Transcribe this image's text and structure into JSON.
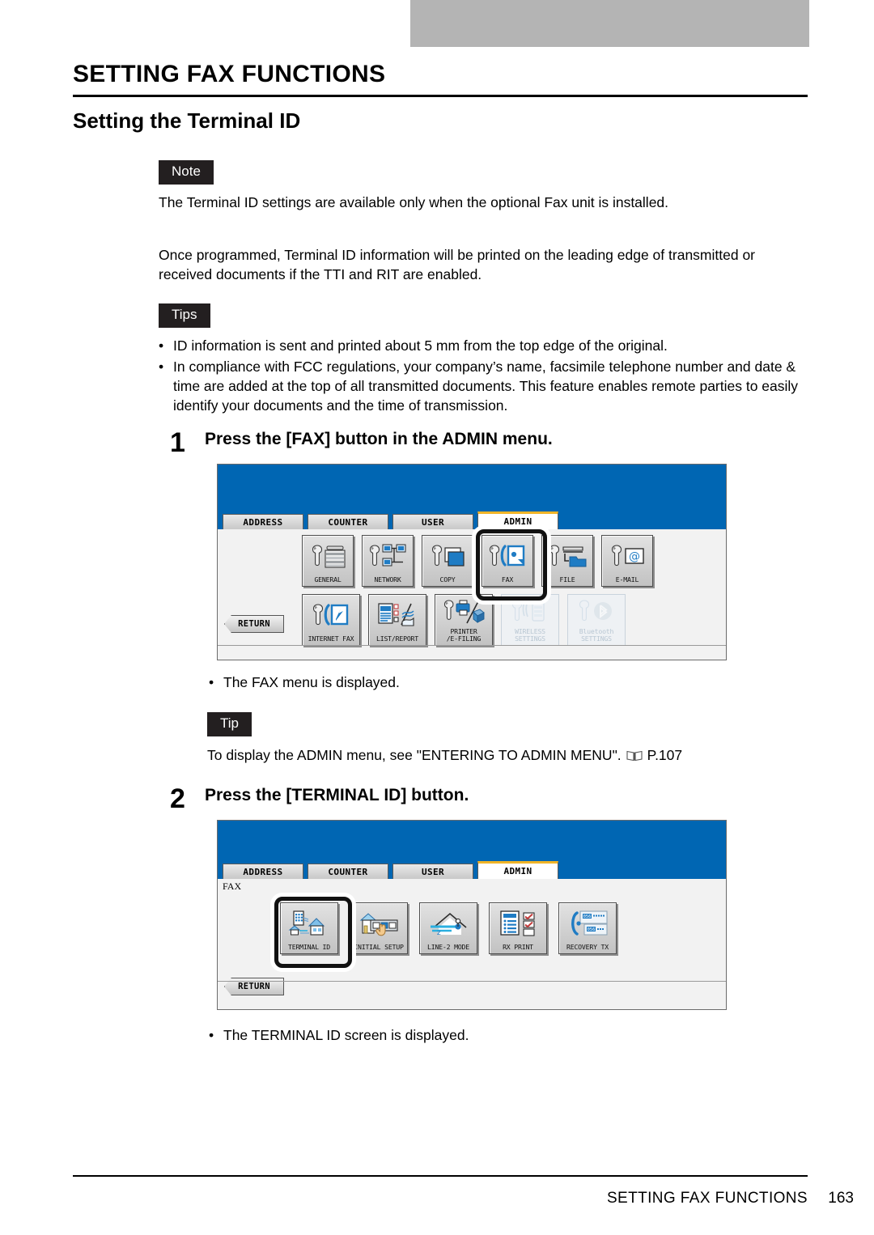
{
  "page": {
    "chapter_title": "SETTING FAX FUNCTIONS",
    "section_title": "Setting the Terminal ID",
    "footer_title": "SETTING FAX FUNCTIONS",
    "footer_page": "163"
  },
  "note": {
    "label": "Note",
    "text": "The Terminal ID settings are available only when the optional Fax unit is installed."
  },
  "intro": {
    "line1": "Once programmed, Terminal ID information will be printed on the leading edge of transmitted or",
    "line2": "received documents if the TTI and RIT are enabled."
  },
  "tips": {
    "label": "Tips",
    "items": [
      "ID information is sent and printed about 5 mm from the top edge of the original.",
      "In compliance with FCC regulations, your company’s name, facsimile telephone number and date & time are added at the top of all transmitted documents.  This feature enables remote parties to easily identify your documents and the time of transmission."
    ]
  },
  "steps": [
    {
      "number": "1",
      "heading": "Press the [FAX] button in the ADMIN menu.",
      "result_bullet": "The FAX menu is displayed."
    },
    {
      "number": "2",
      "heading": "Press the [TERMINAL ID] button.",
      "result_bullet": "The TERMINAL ID screen is displayed."
    }
  ],
  "tip": {
    "label": "Tip",
    "text": "To display the ADMIN menu, see \"ENTERING TO ADMIN MENU\".",
    "ref_page": "P.107"
  },
  "screen1": {
    "tabs": [
      {
        "label": "ADDRESS",
        "active": false
      },
      {
        "label": "COUNTER",
        "active": false
      },
      {
        "label": "USER",
        "active": false
      },
      {
        "label": "ADMIN",
        "active": true
      }
    ],
    "row1": [
      {
        "caption": "GENERAL",
        "icon": "wrench-copier-icon",
        "disabled": false,
        "selected": false
      },
      {
        "caption": "NETWORK",
        "icon": "wrench-network-icon",
        "disabled": false,
        "selected": false
      },
      {
        "caption": "COPY",
        "icon": "wrench-copy-icon",
        "disabled": false,
        "selected": false
      },
      {
        "caption": "FAX",
        "icon": "wrench-fax-icon",
        "disabled": false,
        "selected": true
      },
      {
        "caption": "FILE",
        "icon": "wrench-file-icon",
        "disabled": false,
        "selected": false
      },
      {
        "caption": "E-MAIL",
        "icon": "wrench-email-icon",
        "disabled": false,
        "selected": false
      }
    ],
    "row2": [
      {
        "caption": "INTERNET FAX",
        "icon": "wrench-internet-fax-icon",
        "disabled": false,
        "selected": false
      },
      {
        "caption": "LIST/REPORT",
        "icon": "list-report-icon",
        "disabled": false,
        "selected": false
      },
      {
        "caption": "PRINTER\n/E-FILING",
        "icon": "wrench-printer-efiling-icon",
        "disabled": false,
        "selected": false
      },
      {
        "caption": "WIRELESS\nSETTINGS",
        "icon": "wrench-wireless-icon",
        "disabled": true,
        "selected": false
      },
      {
        "caption": "Bluetooth\nSETTINGS",
        "icon": "wrench-bluetooth-icon",
        "disabled": true,
        "selected": false
      }
    ],
    "return_label": "RETURN"
  },
  "screen2": {
    "tabs": [
      {
        "label": "ADDRESS",
        "active": false
      },
      {
        "label": "COUNTER",
        "active": false
      },
      {
        "label": "USER",
        "active": false
      },
      {
        "label": "ADMIN",
        "active": true
      }
    ],
    "breadcrumb": "FAX",
    "buttons": [
      {
        "caption": "TERMINAL  ID",
        "icon": "buildings-house-icon",
        "selected": true
      },
      {
        "caption": "INITIAL SETUP",
        "icon": "hand-setup-icon",
        "selected": false
      },
      {
        "caption": "LINE-2 MODE",
        "icon": "line2-house-icon",
        "selected": false
      },
      {
        "caption": "RX PRINT",
        "icon": "rx-print-icon",
        "selected": false
      },
      {
        "caption": "RECOVERY TX",
        "icon": "recovery-tx-icon",
        "selected": false
      }
    ],
    "return_label": "RETURN"
  },
  "colors": {
    "lcd_blue": "#0066b3",
    "tab_active_accent": "#f0b428",
    "chip_bg": "#231f20",
    "top_bar": "#b4b4b4"
  }
}
